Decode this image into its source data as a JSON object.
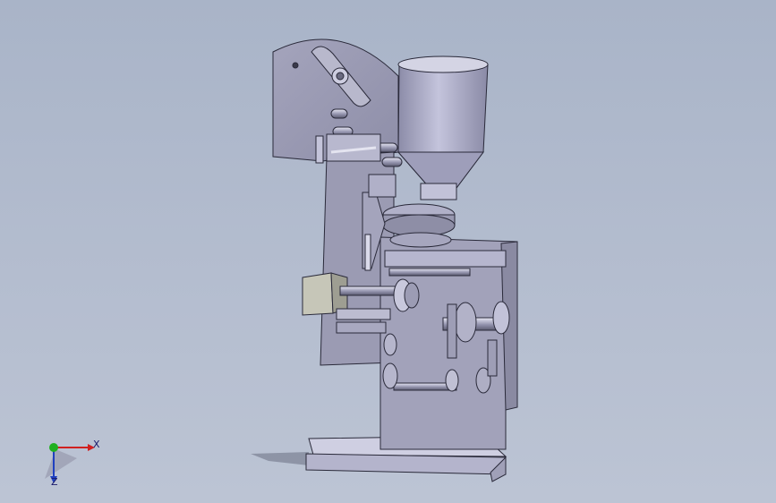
{
  "viewport": {
    "background": "#aab4c8"
  },
  "model": {
    "body_color": "#9a9ab4",
    "edge_color": "#2a2a3a",
    "base_color": "#c2c2d8",
    "hopper_color": "#a8a8c4"
  },
  "triad": {
    "x_label": "X",
    "z_label": "Z",
    "x_color": "#d02020",
    "y_color": "#20b020",
    "z_color": "#2040c0"
  }
}
